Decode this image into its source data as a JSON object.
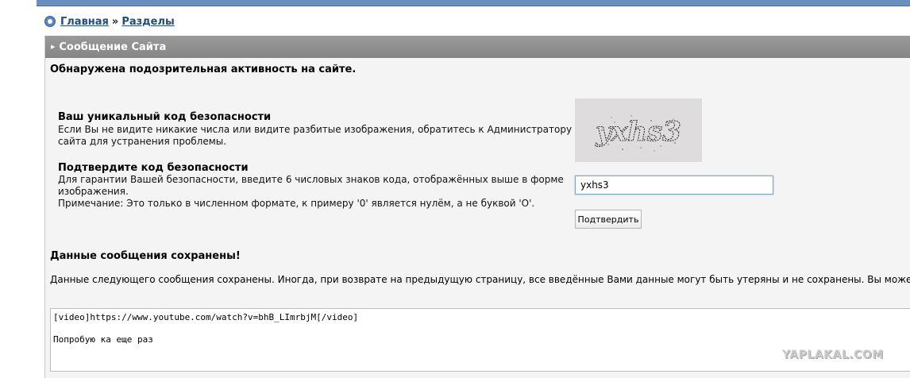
{
  "breadcrumb": {
    "home": "Главная",
    "separator": "»",
    "sections": "Разделы"
  },
  "panel": {
    "title": "Сообщение Сайта",
    "alert": "Обнаружена подозрительная активность на сайте."
  },
  "security": {
    "code_title": "Ваш уникальный код безопасности",
    "code_text_1": "Если Вы не видите никакие числа или видите разбитые изображения, обратитесь к Администратору",
    "code_text_2": "сайта для устранения проблемы.",
    "confirm_title": "Подтвердите код безопасности",
    "confirm_text_1": "Для гарантии Вашей безопасности, введите 6 числовых знаков кода, отображённых выше в форме",
    "confirm_text_2": "изображения.",
    "note": "Примечание: Это только в численном формате, к примеру '0' является нулём, а не буквой 'O'.",
    "captcha_text": "yxhs3",
    "input_value": "yxhs3",
    "button_label": "Подтвердить"
  },
  "saved": {
    "title": "Данные сообщения сохранены!",
    "description": "Данные следующего сообщения сохранены. Иногда, при возврате на предыдущую страницу, все введённые Вами данные могут быть утеряны и не сохранены. Вы можете",
    "message": "[video]https://www.youtube.com/watch?v=bhB_LImrbjM[/video]\n\nПопробую ка еще раз"
  },
  "watermark": "YAPLAKAL.COM",
  "colors": {
    "header_bar": "#6b8fbf",
    "panel_header": "#8e8e8e",
    "link": "#244b7a"
  }
}
